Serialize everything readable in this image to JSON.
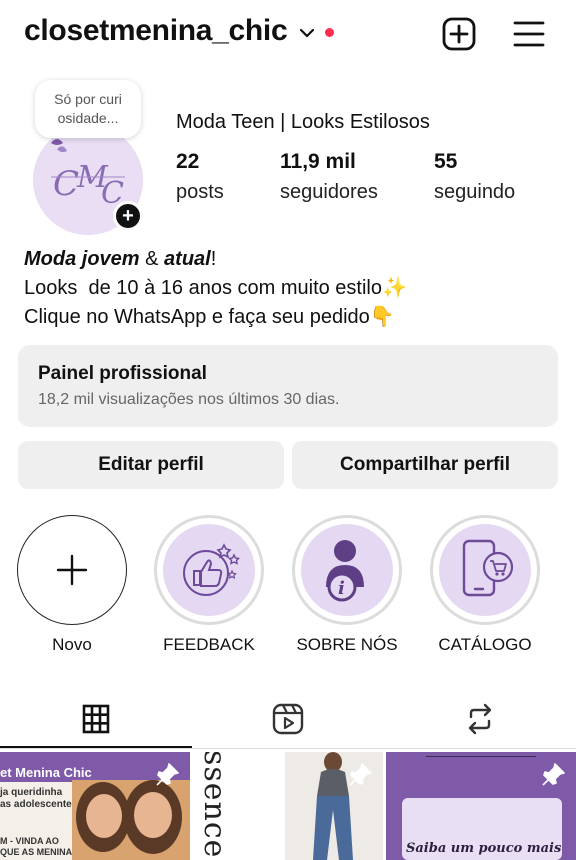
{
  "header": {
    "username": "closetmenina_chic",
    "has_notification_dot": true,
    "accent_dot_color": "#ff2d4f",
    "create_icon": "plus-square-icon",
    "menu_icon": "hamburger-menu-icon"
  },
  "profile": {
    "note_line1": "Só por curi",
    "note_line2": "osidade...",
    "display_name": "Moda Teen | Looks Estilosos",
    "stats": [
      {
        "value": "22",
        "label": "posts"
      },
      {
        "value": "11,9 mil",
        "label": "seguidores"
      },
      {
        "value": "55",
        "label": "seguindo"
      }
    ]
  },
  "bio": {
    "line1_bold1": "Moda jovem",
    "line1_mid": " & ",
    "line1_bold2": "atual",
    "line1_end": "!",
    "line2": "Looks  de 10 à 16 anos com muito estilo✨",
    "line3": "Clique no WhatsApp e faça seu pedido👇"
  },
  "dashboard": {
    "title": "Painel profissional",
    "subtitle": "18,2 mil visualizações nos últimos 30 dias."
  },
  "actions": {
    "edit_label": "Editar perfil",
    "share_label": "Compartilhar perfil"
  },
  "highlights": [
    {
      "label": "Novo",
      "icon": "plus-icon"
    },
    {
      "label": "FEEDBACK",
      "icon": "thumbs-up-icon"
    },
    {
      "label": "SOBRE NÓS",
      "icon": "user-info-icon"
    },
    {
      "label": "CATÁLOGO",
      "icon": "phone-cart-icon"
    }
  ],
  "tabs": [
    {
      "icon": "grid-icon",
      "active": true
    },
    {
      "icon": "reels-icon",
      "active": false
    },
    {
      "icon": "repost-icon",
      "active": false
    }
  ],
  "posts": {
    "post1": {
      "banner": "et Menina Chic",
      "text_a": "ja queridinha",
      "text_b": "as adolescentes!",
      "text_c": "M - VINDA AO",
      "text_d": "QUE AS MENINAS"
    },
    "post2": {
      "word": "ssence"
    },
    "post3": {
      "text": "Saiba um pouco mais"
    }
  },
  "colors": {
    "brand_purple": "#7e5aa8",
    "highlight_fill": "#e4d8f2",
    "button_bg": "#efefef"
  }
}
